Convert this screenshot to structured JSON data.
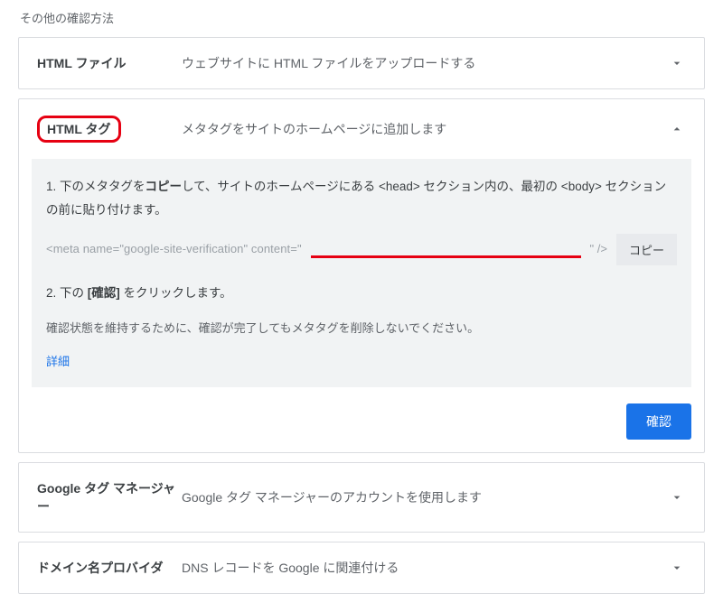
{
  "sectionLabel": "その他の確認方法",
  "panels": {
    "htmlFile": {
      "title": "HTML ファイル",
      "desc": "ウェブサイトに HTML ファイルをアップロードする"
    },
    "htmlTag": {
      "title": "HTML タグ",
      "desc": "メタタグをサイトのホームページに追加します",
      "step1_a": "1. 下のメタタグを",
      "step1_bold": "コピー",
      "step1_b": "して、サイトのホームページにある <head> セクション内の、最初の <body> セクションの前に貼り付けます。",
      "code_open": "<meta name=\"google-site-verification\" content=\"",
      "code_close": "\" />",
      "copyLabel": "コピー",
      "step2_a": "2. 下の ",
      "step2_bold": "[確認]",
      "step2_b": " をクリックします。",
      "note": "確認状態を維持するために、確認が完了してもメタタグを削除しないでください。",
      "detailsLink": "詳細",
      "confirmLabel": "確認"
    },
    "tagManager": {
      "title": "Google タグ マネージャー",
      "desc": "Google タグ マネージャーのアカウントを使用します"
    },
    "dnsProvider": {
      "title": "ドメイン名プロバイダ",
      "desc": "DNS レコードを Google に関連付ける"
    }
  }
}
